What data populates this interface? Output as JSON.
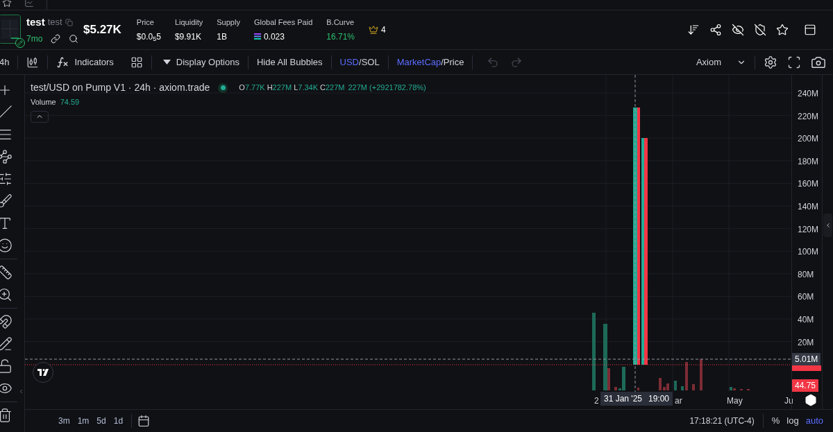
{
  "token": {
    "name": "test",
    "ticker": "test",
    "age": "7mo",
    "market_cap": "$5.27K"
  },
  "stats": [
    {
      "label": "Price",
      "value": "$0.0$_{5}$5",
      "kind": "plain"
    },
    {
      "label": "Liquidity",
      "value": "$9.91K",
      "kind": "plain"
    },
    {
      "label": "Supply",
      "value": "1B",
      "kind": "plain"
    },
    {
      "label": "Global Fees Paid",
      "value": "0.023",
      "kind": "sol"
    },
    {
      "label": "B.Curve",
      "value": "16.71%",
      "kind": "positive"
    }
  ],
  "crown_count": "4",
  "toolbar": {
    "interval": "4h",
    "indicators": "Indicators",
    "display_options": "Display Options",
    "hide_bubbles": "Hide All Bubbles",
    "toggles": [
      {
        "separator": "/",
        "options": [
          {
            "label": "USD",
            "selected": true
          },
          {
            "label": "SOL",
            "selected": false
          }
        ]
      },
      {
        "separator": "/",
        "options": [
          {
            "label": "MarketCap",
            "selected": true
          },
          {
            "label": "Price",
            "selected": false
          }
        ]
      }
    ],
    "history": [
      {
        "kind": "undo",
        "disabled": true
      },
      {
        "kind": "redo",
        "disabled": true
      }
    ],
    "theme": "Axiom"
  },
  "legend": {
    "symbol": "test/USD on Pump V1 · 24h · axiom.trade",
    "ohlc": [
      {
        "key": "O",
        "value": "7.77K"
      },
      {
        "key": "H",
        "value": "227M"
      },
      {
        "key": "L",
        "value": "7.34K"
      },
      {
        "key": "C",
        "value": "227M"
      }
    ],
    "change": "227M (+2921782.78%)",
    "volume_label": "Volume",
    "volume_value": "74.59"
  },
  "price_axis": {
    "ticks": [
      "240M",
      "220M",
      "200M",
      "180M",
      "160M",
      "140M",
      "120M",
      "100M",
      "80M",
      "60M",
      "40M",
      "20M"
    ],
    "markers": [
      {
        "text": "5.01M",
        "color": "#363a45"
      },
      {
        "text": "44.75",
        "color": "#f23645"
      }
    ]
  },
  "time_axis": {
    "labels": [
      "2",
      "ar",
      "May",
      "Ju"
    ],
    "crosshair": {
      "date": "31 Jan '25",
      "time": "19:00"
    }
  },
  "bottom_bar": {
    "ranges": [
      "3m",
      "1m",
      "5d",
      "1d"
    ],
    "clock": "17:18:21 (UTC-4)",
    "scale_options": [
      {
        "label": "%",
        "selected": false
      },
      {
        "label": "log",
        "selected": false
      },
      {
        "label": "auto",
        "selected": true
      }
    ]
  }
}
